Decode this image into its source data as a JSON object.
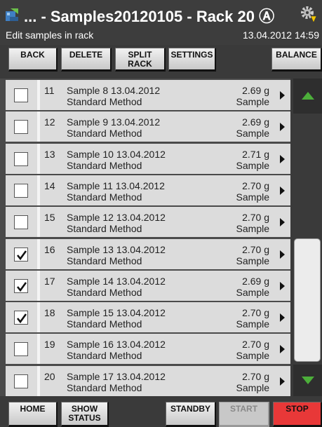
{
  "header": {
    "title": "... - Samples20120105 - Rack 20 Ⓐ",
    "subtitle": "Edit samples in rack",
    "datetime": "13.04.2012 14:59"
  },
  "toolbar": {
    "back": "BACK",
    "delete": "DELETE",
    "split_rack": "SPLIT\nRACK",
    "settings": "SETTINGS",
    "balance": "BALANCE"
  },
  "samples": [
    {
      "num": "11",
      "name": "Sample 8 13.04.2012",
      "method": "Standard Method",
      "weight": "2.69 g",
      "kind": "Sample",
      "checked": false
    },
    {
      "num": "12",
      "name": "Sample 9 13.04.2012",
      "method": "Standard Method",
      "weight": "2.69 g",
      "kind": "Sample",
      "checked": false
    },
    {
      "num": "13",
      "name": "Sample 10 13.04.2012",
      "method": "Standard Method",
      "weight": "2.71 g",
      "kind": "Sample",
      "checked": false
    },
    {
      "num": "14",
      "name": "Sample 11 13.04.2012",
      "method": "Standard Method",
      "weight": "2.70 g",
      "kind": "Sample",
      "checked": false
    },
    {
      "num": "15",
      "name": "Sample 12 13.04.2012",
      "method": "Standard Method",
      "weight": "2.70 g",
      "kind": "Sample",
      "checked": false
    },
    {
      "num": "16",
      "name": "Sample 13 13.04.2012",
      "method": "Standard Method",
      "weight": "2.70 g",
      "kind": "Sample",
      "checked": true
    },
    {
      "num": "17",
      "name": "Sample 14 13.04.2012",
      "method": "Standard Method",
      "weight": "2.69 g",
      "kind": "Sample",
      "checked": true
    },
    {
      "num": "18",
      "name": "Sample 15 13.04.2012",
      "method": "Standard Method",
      "weight": "2.70 g",
      "kind": "Sample",
      "checked": true
    },
    {
      "num": "19",
      "name": "Sample 16 13.04.2012",
      "method": "Standard Method",
      "weight": "2.70 g",
      "kind": "Sample",
      "checked": false
    },
    {
      "num": "20",
      "name": "Sample 17 13.04.2012",
      "method": "Standard Method",
      "weight": "2.70 g",
      "kind": "Sample",
      "checked": false
    }
  ],
  "footer": {
    "home": "HOME",
    "show_status": "SHOW\nSTATUS",
    "standby": "STANDBY",
    "start": "START",
    "stop": "STOP"
  },
  "icons": {
    "app": "rack-app-icon",
    "settings": "gear-warning-icon",
    "scroll_up": "triangle-up-icon",
    "scroll_down": "triangle-down-icon",
    "row_arrow": "chevron-right-icon"
  },
  "colors": {
    "accent_green": "#4caf3a",
    "stop_red": "#e83838"
  }
}
